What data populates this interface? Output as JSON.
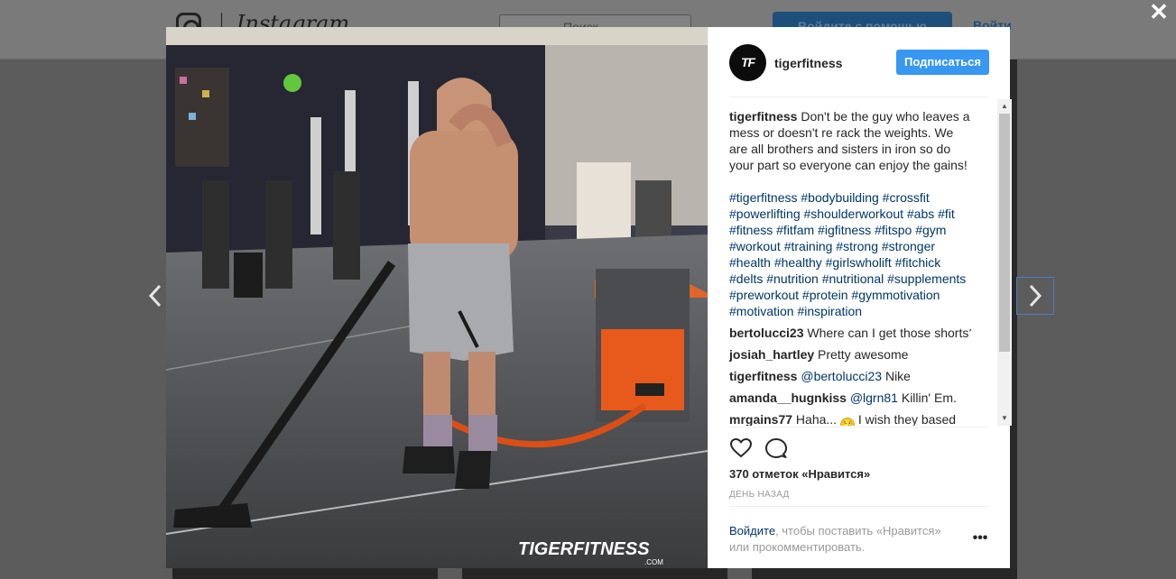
{
  "background_header": {
    "wordmark": "Instagram",
    "search_placeholder": "Поиск",
    "signup_button": "Войдите с помощью",
    "login_link": "Войти"
  },
  "modal": {
    "close_label": "✕",
    "nav_prev": "‹",
    "nav_next": "›",
    "avatar_text": "TF",
    "username": "tigerfitness",
    "follow_button": "Подписаться",
    "photo_watermark": "TIGERFITNESS",
    "photo_watermark_sub": ".COM",
    "caption": {
      "user": "tigerfitness",
      "text": " Don't be the guy who leaves a mess or doesn't re rack the weights. We are all brothers and sisters in iron so do your part so everyone can enjoy the gains!"
    },
    "hashtags": "#tigerfitness #bodybuilding #crossfit #powerlifting #shoulderworkout #abs #fit #fitness #fitfam #igfitness #fitspo #gym #workout #training #strong #stronger #health #healthy #girlswholift #fitchick #delts #nutrition #nutritional #supplements #preworkout #protein #gymmotivation #motivation #inspiration",
    "comments": [
      {
        "user": "bertolucci23",
        "mention": "",
        "text": " Where can I get those shorts?"
      },
      {
        "user": "josiah_hartley",
        "mention": "",
        "text": " Pretty awesome"
      },
      {
        "user": "tigerfitness",
        "mention": " @bertolucci23",
        "text": " Nike"
      },
      {
        "user": "amanda__hugnkiss",
        "mention": " @lgrn81",
        "text": " Killin' Em."
      }
    ],
    "last_comment": {
      "user": "mrgains77",
      "text_before": " Haha... ",
      "emoji": "😏",
      "text_after": " I wish they based"
    },
    "likes": "370 отметок «Нравится»",
    "timestamp": "ДЕНЬ НАЗАД",
    "login_prompt": {
      "link": "Войдите",
      "text": ", чтобы поставить «Нравится» или прокомментировать."
    },
    "more_label": "•••"
  },
  "colors": {
    "follow_button": "#3897f0",
    "link": "#003569",
    "overlay": "#5c5c5c"
  },
  "icons": {
    "like": "heart-outline-icon",
    "comment": "speech-bubble-icon",
    "close": "close-icon",
    "prev": "chevron-left-icon",
    "next": "chevron-right-icon"
  }
}
